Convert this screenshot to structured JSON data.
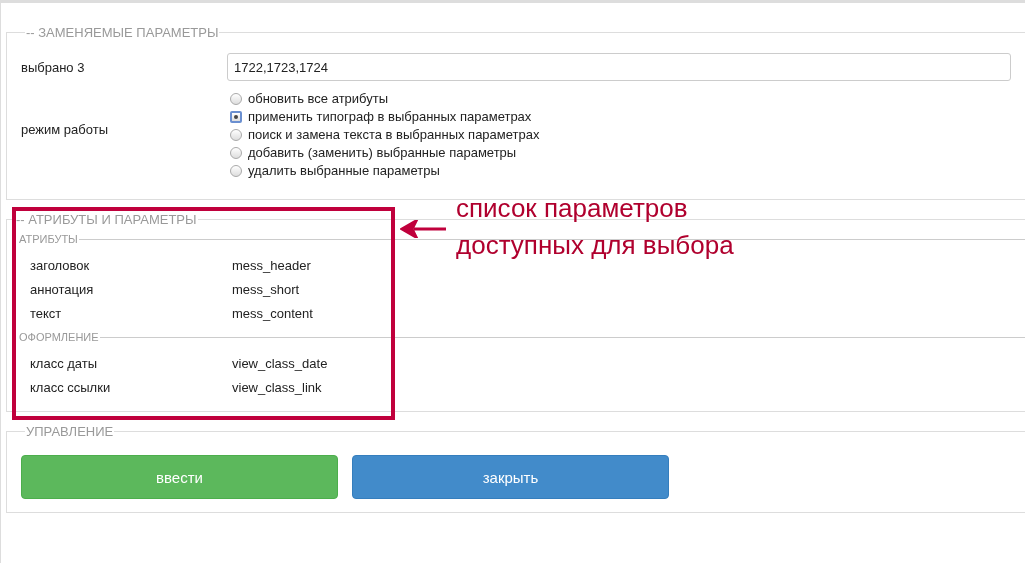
{
  "replace_section": {
    "legend": "-- ЗАМЕНЯЕМЫЕ ПАРАМЕТРЫ",
    "selected_label": "выбрано 3",
    "selected_value": "1722,1723,1724",
    "mode_label": "режим работы",
    "modes": [
      {
        "label": "обновить все атрибуты",
        "selected": false
      },
      {
        "label": "применить типограф в выбранных параметрах",
        "selected": true
      },
      {
        "label": "поиск и замена текста в выбранных параметрах",
        "selected": false
      },
      {
        "label": "добавить (заменить) выбранные параметры",
        "selected": false
      },
      {
        "label": "удалить выбранные параметры",
        "selected": false
      }
    ]
  },
  "params_section": {
    "legend": "-- АТРИБУТЫ И ПАРАМЕТРЫ",
    "groups": [
      {
        "title": "АТРИБУТЫ",
        "rows": [
          {
            "name": "заголовок",
            "key": "mess_header"
          },
          {
            "name": "аннотация",
            "key": "mess_short"
          },
          {
            "name": "текст",
            "key": "mess_content"
          }
        ]
      },
      {
        "title": "ОФОРМЛЕНИЕ",
        "rows": [
          {
            "name": "класс даты",
            "key": "view_class_date"
          },
          {
            "name": "класс ссылки",
            "key": "view_class_link"
          }
        ]
      }
    ]
  },
  "control_section": {
    "legend": "УПРАВЛЕНИЕ",
    "buttons": [
      {
        "label": "ввести",
        "kind": "submit"
      },
      {
        "label": "закрыть",
        "kind": "close"
      }
    ]
  },
  "annotation": {
    "lines": [
      "список параметров",
      "доступных для выбора"
    ]
  }
}
